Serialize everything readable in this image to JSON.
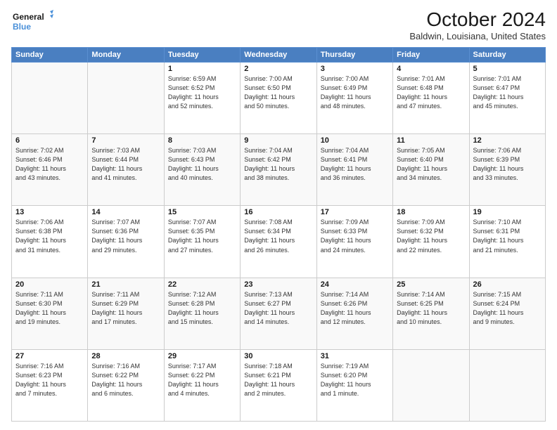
{
  "header": {
    "logo_line1": "General",
    "logo_line2": "Blue",
    "title": "October 2024",
    "location": "Baldwin, Louisiana, United States"
  },
  "days_of_week": [
    "Sunday",
    "Monday",
    "Tuesday",
    "Wednesday",
    "Thursday",
    "Friday",
    "Saturday"
  ],
  "weeks": [
    [
      {
        "day": "",
        "info": ""
      },
      {
        "day": "",
        "info": ""
      },
      {
        "day": "1",
        "info": "Sunrise: 6:59 AM\nSunset: 6:52 PM\nDaylight: 11 hours\nand 52 minutes."
      },
      {
        "day": "2",
        "info": "Sunrise: 7:00 AM\nSunset: 6:50 PM\nDaylight: 11 hours\nand 50 minutes."
      },
      {
        "day": "3",
        "info": "Sunrise: 7:00 AM\nSunset: 6:49 PM\nDaylight: 11 hours\nand 48 minutes."
      },
      {
        "day": "4",
        "info": "Sunrise: 7:01 AM\nSunset: 6:48 PM\nDaylight: 11 hours\nand 47 minutes."
      },
      {
        "day": "5",
        "info": "Sunrise: 7:01 AM\nSunset: 6:47 PM\nDaylight: 11 hours\nand 45 minutes."
      }
    ],
    [
      {
        "day": "6",
        "info": "Sunrise: 7:02 AM\nSunset: 6:46 PM\nDaylight: 11 hours\nand 43 minutes."
      },
      {
        "day": "7",
        "info": "Sunrise: 7:03 AM\nSunset: 6:44 PM\nDaylight: 11 hours\nand 41 minutes."
      },
      {
        "day": "8",
        "info": "Sunrise: 7:03 AM\nSunset: 6:43 PM\nDaylight: 11 hours\nand 40 minutes."
      },
      {
        "day": "9",
        "info": "Sunrise: 7:04 AM\nSunset: 6:42 PM\nDaylight: 11 hours\nand 38 minutes."
      },
      {
        "day": "10",
        "info": "Sunrise: 7:04 AM\nSunset: 6:41 PM\nDaylight: 11 hours\nand 36 minutes."
      },
      {
        "day": "11",
        "info": "Sunrise: 7:05 AM\nSunset: 6:40 PM\nDaylight: 11 hours\nand 34 minutes."
      },
      {
        "day": "12",
        "info": "Sunrise: 7:06 AM\nSunset: 6:39 PM\nDaylight: 11 hours\nand 33 minutes."
      }
    ],
    [
      {
        "day": "13",
        "info": "Sunrise: 7:06 AM\nSunset: 6:38 PM\nDaylight: 11 hours\nand 31 minutes."
      },
      {
        "day": "14",
        "info": "Sunrise: 7:07 AM\nSunset: 6:36 PM\nDaylight: 11 hours\nand 29 minutes."
      },
      {
        "day": "15",
        "info": "Sunrise: 7:07 AM\nSunset: 6:35 PM\nDaylight: 11 hours\nand 27 minutes."
      },
      {
        "day": "16",
        "info": "Sunrise: 7:08 AM\nSunset: 6:34 PM\nDaylight: 11 hours\nand 26 minutes."
      },
      {
        "day": "17",
        "info": "Sunrise: 7:09 AM\nSunset: 6:33 PM\nDaylight: 11 hours\nand 24 minutes."
      },
      {
        "day": "18",
        "info": "Sunrise: 7:09 AM\nSunset: 6:32 PM\nDaylight: 11 hours\nand 22 minutes."
      },
      {
        "day": "19",
        "info": "Sunrise: 7:10 AM\nSunset: 6:31 PM\nDaylight: 11 hours\nand 21 minutes."
      }
    ],
    [
      {
        "day": "20",
        "info": "Sunrise: 7:11 AM\nSunset: 6:30 PM\nDaylight: 11 hours\nand 19 minutes."
      },
      {
        "day": "21",
        "info": "Sunrise: 7:11 AM\nSunset: 6:29 PM\nDaylight: 11 hours\nand 17 minutes."
      },
      {
        "day": "22",
        "info": "Sunrise: 7:12 AM\nSunset: 6:28 PM\nDaylight: 11 hours\nand 15 minutes."
      },
      {
        "day": "23",
        "info": "Sunrise: 7:13 AM\nSunset: 6:27 PM\nDaylight: 11 hours\nand 14 minutes."
      },
      {
        "day": "24",
        "info": "Sunrise: 7:14 AM\nSunset: 6:26 PM\nDaylight: 11 hours\nand 12 minutes."
      },
      {
        "day": "25",
        "info": "Sunrise: 7:14 AM\nSunset: 6:25 PM\nDaylight: 11 hours\nand 10 minutes."
      },
      {
        "day": "26",
        "info": "Sunrise: 7:15 AM\nSunset: 6:24 PM\nDaylight: 11 hours\nand 9 minutes."
      }
    ],
    [
      {
        "day": "27",
        "info": "Sunrise: 7:16 AM\nSunset: 6:23 PM\nDaylight: 11 hours\nand 7 minutes."
      },
      {
        "day": "28",
        "info": "Sunrise: 7:16 AM\nSunset: 6:22 PM\nDaylight: 11 hours\nand 6 minutes."
      },
      {
        "day": "29",
        "info": "Sunrise: 7:17 AM\nSunset: 6:22 PM\nDaylight: 11 hours\nand 4 minutes."
      },
      {
        "day": "30",
        "info": "Sunrise: 7:18 AM\nSunset: 6:21 PM\nDaylight: 11 hours\nand 2 minutes."
      },
      {
        "day": "31",
        "info": "Sunrise: 7:19 AM\nSunset: 6:20 PM\nDaylight: 11 hours\nand 1 minute."
      },
      {
        "day": "",
        "info": ""
      },
      {
        "day": "",
        "info": ""
      }
    ]
  ]
}
